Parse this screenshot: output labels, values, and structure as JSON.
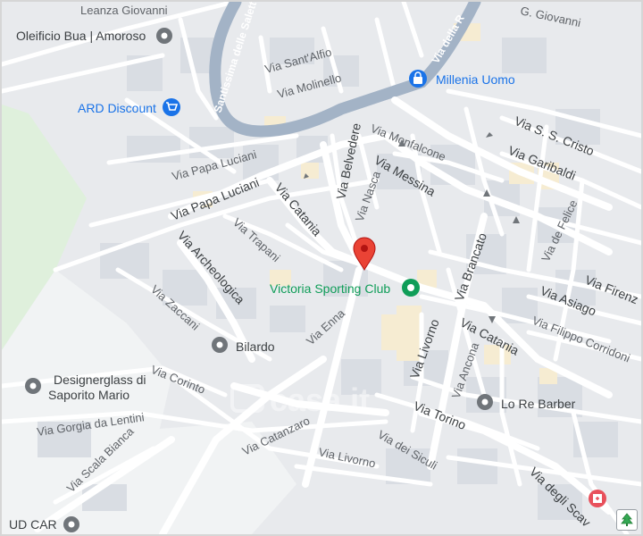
{
  "streets": {
    "santissima": "Santissima delle Salette",
    "della_r": "Via della R",
    "giovanni_top": "Leanza Giovanni",
    "giovanni_right": "G. Giovanni",
    "sant_alfio": "Via Sant'Alfio",
    "molinello": "Via Molinello",
    "monfalcone": "Via Monfalcone",
    "ss_cristo": "Via S. S. Cristo",
    "garibaldi": "Via Garibaldi",
    "messina": "Via Messina",
    "belvedere": "Via Belvedere",
    "nasca": "Via Nasca",
    "papa_luciani_small": "Via Papa Luciani",
    "papa_luciani_big": "Via Papa Luciani",
    "catania_upper": "Via Catania",
    "trapani": "Via Trapani",
    "archeologica": "Via Archeologica",
    "de_felice": "Via de Felice",
    "brancato": "Via Brancato",
    "firenze": "Via Firenz",
    "asiago": "Via Asiago",
    "filippo_corridoni": "Via Filippo Corridoni",
    "catania_lower": "Via Catania",
    "zaccani": "Via Zaccani",
    "enna": "Via Enna",
    "corinto": "Via Corinto",
    "livorno_upper": "Via Livorno",
    "ancona": "Via Ancona",
    "torino": "Via Torino",
    "gorgia": "Via Gorgia da Lentini",
    "catanzaro": "Via Catanzaro",
    "dei_siculi": "Via dei Siculi",
    "livorno_lower": "Via Livorno",
    "scala_bianca": "Via Scala Bianca",
    "degli_scav": "Via degli Scav"
  },
  "pois": {
    "oleificio": "Oleificio Bua | Amoroso",
    "ard": "ARD Discount",
    "millenia": "Millenia Uomo",
    "victoria": "Victoria Sporting Club",
    "bilardo": "Bilardo",
    "designerglass_1": "Designerglass di",
    "designerglass_2": "Saporito Mario",
    "lo_re": "Lo Re Barber",
    "ud_car": "UD CAR"
  },
  "watermark": "casa.it",
  "icons": {
    "pin": "location-pin-icon",
    "cart": "shopping-cart-icon",
    "bag": "shopping-bag-icon",
    "fitness": "fitness-icon",
    "generic": "place-icon",
    "shield": "shield-icon",
    "control": "map-control-icon"
  },
  "colors": {
    "land": "#e8eaed",
    "road": "#ffffff",
    "arterial": "#a3b3c6",
    "park": "#dff0dc",
    "poi_blue": "#1a73e8",
    "poi_gray": "#70757a",
    "poi_green": "#0f9d58",
    "pin_red": "#ea4335"
  }
}
